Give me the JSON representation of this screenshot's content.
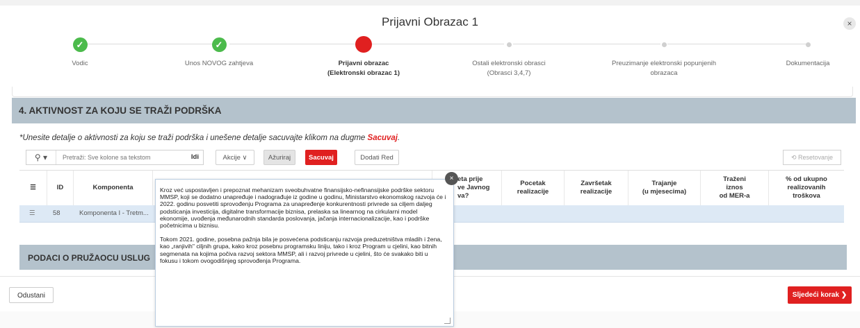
{
  "modal": {
    "title": "Prijavni Obrazac 1",
    "close": "×"
  },
  "steps": [
    {
      "label": "Vodic",
      "state": "done"
    },
    {
      "label": "Unos NOVOG zahtjeva",
      "state": "done"
    },
    {
      "label": "Prijavni obrazac",
      "label2": "(Elektronski obrazac 1)",
      "state": "current"
    },
    {
      "label": "Ostali elektronski obrasci",
      "label2": "(Obrasci 3,4,7)",
      "state": "future"
    },
    {
      "label": "Preuzimanje elektronski popunjenih",
      "label2": "obrazaca",
      "state": "future"
    },
    {
      "label": "Dokumentacija",
      "state": "future"
    }
  ],
  "section": {
    "title": "4. AKTIVNOST ZA KOJU SE TRAŽI PODRŠKA",
    "instructions": "*Unesite detalje o aktivnosti za koju se traži podrška i unešene detalje sacuvajte klikom na dugme ",
    "instructions_emphasis": "Sacuvaj",
    "instructions_end": "."
  },
  "toolbar": {
    "search_placeholder": "Pretraži: Sve kolone sa tekstom",
    "go_label": "Idi",
    "actions_label": "Akcije",
    "refresh_label": "Ažuriraj",
    "save_label": "Sacuvaj",
    "add_row_label": "Dodati Red",
    "reset_label": "Resetovanje"
  },
  "grid": {
    "columns": [
      "ID",
      "Komponenta",
      "",
      "",
      "",
      "",
      "eta prije\nve Javnog\nva?",
      "Pocetak\nrealizacije",
      "Završetak\nrealizacije",
      "Trajanje\n(u mjesecima)",
      "Traženi\niznos\nod MER-a",
      "% od ukupno\nrealizovanih\ntroškova"
    ],
    "row": {
      "id": "58",
      "komponenta": "Komponenta I - Tretm..."
    }
  },
  "podaci": {
    "title": "PODACI O PRUŽAOCU USLUG"
  },
  "popup": {
    "paragraph1": "Kroz već uspostavljen i prepoznat mehanizam sveobuhvatne finansijsko-nefinansijske podrške sektoru MMSP, koji se dodatno unapređuje i nadograđuje iz godine u godinu, Ministarstvo ekonomskog razvoja će i 2022. godinu posvetiti sprovođenju Programa za unapređenje konkurentnosti privrede sa ciljem daljeg podsticanja investicija, digitalne transformacije biznisa, prelaska sa linearnog na cirkularni model ekonomije, uvođenja međunarodnih standarda poslovanja, jačanja internacionalizacije, kao i podrške početnicima u biznisu.",
    "paragraph2": "Tokom 2021. godine, posebna pažnja bila je posvećena podsticanju razvoja preduzetništva mladih i žena, kao „ranjivih\" ciljnih grupa, kako kroz posebnu programsku liniju, tako i kroz Program u cjelini, kao bitnih segmenata na kojima počiva razvoj sektora MMSP, ali i razvoj privrede u cjelini, što će svakako biti u fokusu  i tokom ovogodišnjeg sprovođenja Programa.",
    "close": "×"
  },
  "footer": {
    "cancel_label": "Odustani",
    "next_label": "Sljedeći korak"
  },
  "colors": {
    "accent_red": "#e02020",
    "done_green": "#4cbb4c",
    "section_bg": "#b4c2cc",
    "row_selected": "#dde9f5"
  }
}
